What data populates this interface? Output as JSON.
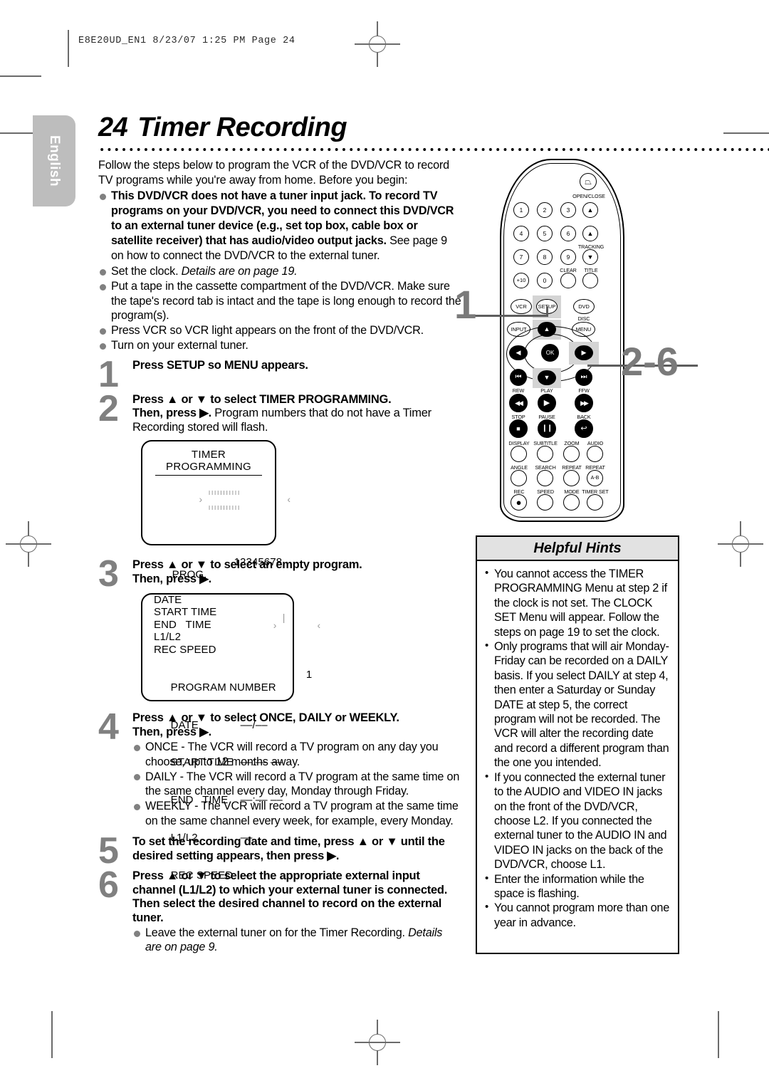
{
  "print_header": "E8E20UD_EN1  8/23/07  1:25 PM  Page 24",
  "language_tab": "English",
  "title": {
    "number": "24",
    "text": "Timer Recording"
  },
  "intro": "Follow the steps below to program the VCR of the DVD/VCR to record TV programs while you're away from home. Before you begin:",
  "prereq_bullets": [
    {
      "bold": "This DVD/VCR does not have a tuner input jack. To record TV programs on your DVD/VCR, you need to connect this DVD/VCR to an external tuner device (e.g., set top box, cable box or satellite receiver) that has audio/video output jacks.",
      "normal": " See page 9 on how to connect the DVD/VCR to the external tuner."
    },
    {
      "normal": "Set the clock. ",
      "italic": "Details are on page 19."
    },
    {
      "normal": "Put a tape in the cassette compartment of the DVD/VCR. Make sure the tape's record tab is intact and the tape is long enough to record the program(s)."
    },
    {
      "normal": "Press VCR so VCR light appears on the front of the DVD/VCR."
    },
    {
      "normal": "Turn on your external tuner."
    }
  ],
  "steps": [
    {
      "num": "1",
      "lead": "Press SETUP so MENU appears."
    },
    {
      "num": "2",
      "lead": "Press ▲ or ▼ to select TIMER PROGRAMMING.",
      "lead2": "Then, press ▶.",
      "lead2_normal": " Program numbers that do not have a Timer Recording stored will flash."
    },
    {
      "num": "3",
      "lead": "Press ▲ or ▼ to select an empty program.",
      "lead2": "Then, press ▶."
    },
    {
      "num": "4",
      "lead": "Press ▲ or ▼ to select ONCE, DAILY or WEEKLY.",
      "lead2": "Then, press ▶.",
      "bullets": [
        "ONCE - The VCR will record a TV program on any day you choose, up to 12 months away.",
        "DAILY - The VCR will record a TV program at the same time on the same channel every day, Monday through Friday.",
        "WEEKLY - The VCR will record a TV program at the same time on the same channel every week, for example, every Monday."
      ]
    },
    {
      "num": "5",
      "lead": "To set the recording date and time, press ▲ or ▼ until the desired setting appears, then press ▶."
    },
    {
      "num": "6",
      "lead": "Press ▲ or ▼ to select the appropriate external input channel (L1/L2) to which your external tuner is connected. Then select the desired channel to record on the external tuner.",
      "bullet_normal": "Leave the external tuner on for the Timer Recording. ",
      "bullet_italic": "Details are on page 9."
    }
  ],
  "osd_timer_programming": {
    "title": "TIMER PROGRAMMING",
    "prog_label": "PROG.",
    "prog_value": "12345678",
    "rows": [
      "DATE",
      "START TIME",
      "END   TIME",
      "L1/L2",
      "REC SPEED"
    ]
  },
  "osd_program_number": {
    "rows": [
      {
        "label": "PROGRAM NUMBER",
        "value": "1",
        "flash": true
      },
      {
        "label": "DATE",
        "value": "––/––"
      },
      {
        "label": "START TIME",
        "value": "––:–– ––"
      },
      {
        "label": "END   TIME",
        "value": "––:–– ––"
      },
      {
        "label": "L1/L2",
        "value": "––"
      },
      {
        "label": "REC SPEED",
        "value": "––"
      }
    ]
  },
  "callouts": {
    "one": "1",
    "two_six": "2-6"
  },
  "remote": {
    "power_label": "OPEN/CLOSE",
    "numeric": [
      "1",
      "2",
      "3",
      "4",
      "5",
      "6",
      "7",
      "8",
      "9",
      "+10",
      "0"
    ],
    "open_close": "▲",
    "tracking_label": "TRACKING",
    "tracking_up": "▲",
    "tracking_down": "▼",
    "clear_label": "CLEAR",
    "title_label": "TITLE",
    "vcr": "VCR",
    "setup": "SETUP",
    "dvd": "DVD",
    "disc_label": "DISC",
    "input": "INPUT",
    "menu": "MENU",
    "ok": "OK",
    "up": "▲",
    "down": "▼",
    "left": "◀",
    "right": "▶",
    "prev": "⏮",
    "next": "⏭",
    "rew_label": "REW",
    "play_label": "PLAY",
    "ffw_label": "FFW",
    "rew_glyph": "◀◀",
    "play_glyph": "▶",
    "ffw_glyph": "▶▶",
    "stop_label": "STOP",
    "pause_label": "PAUSE",
    "back_label": "BACK",
    "stop_glyph": "■",
    "pause_glyph": "❙❙",
    "back_glyph": "↩",
    "row_a": [
      "DISPLAY",
      "SUBTITLE",
      "ZOOM",
      "AUDIO"
    ],
    "row_b": [
      "ANGLE",
      "SEARCH",
      "REPEAT",
      "REPEAT"
    ],
    "ab_label": "A-B",
    "row_c": [
      "REC",
      "SPEED",
      "MODE",
      "TIMER SET"
    ]
  },
  "hints": {
    "title": "Helpful Hints",
    "items": [
      "You cannot access the TIMER PROGRAMMING Menu at step 2 if the clock is not set. The CLOCK SET Menu will appear. Follow the steps on page 19 to set the clock.",
      "Only programs that will air Monday-Friday can be recorded on a DAILY basis. If you select DAILY at step 4, then enter a Saturday or Sunday DATE at step 5, the correct program will not be recorded. The VCR will alter the recording date and record a different program than the one you intended.",
      "If you connected the external tuner to the AUDIO and VIDEO IN jacks on the front of the DVD/VCR, choose L2. If you connected the external tuner to the AUDIO IN and VIDEO IN jacks on the back of the DVD/VCR, choose L1.",
      "Enter the information while the space is flashing.",
      "You cannot program more than one year in advance."
    ]
  }
}
